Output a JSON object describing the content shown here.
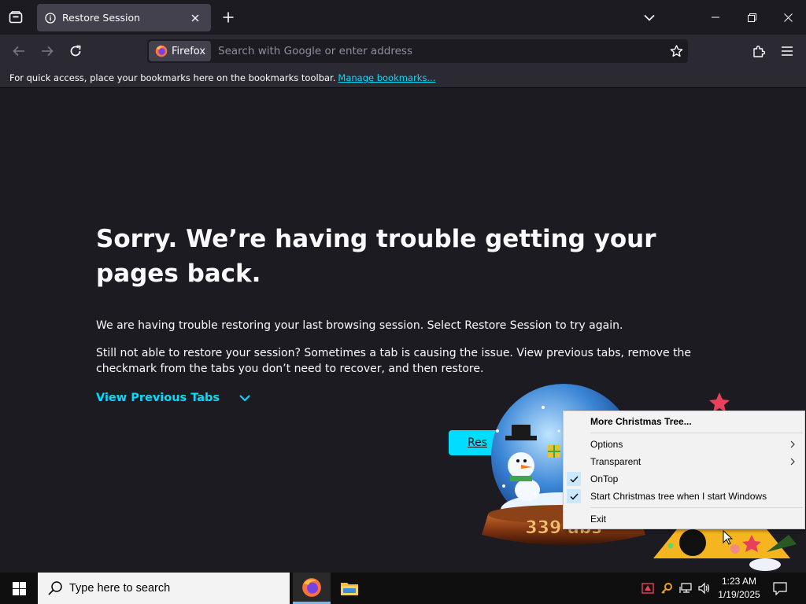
{
  "browser": {
    "tab": {
      "title": "Restore Session",
      "icon": "info-icon"
    },
    "urlbar": {
      "identity_label": "Firefox",
      "placeholder": "Search with Google or enter address"
    },
    "bookmarks_bar": {
      "message": "For quick access, place your bookmarks here on the bookmarks toolbar.",
      "link": "Manage bookmarks..."
    }
  },
  "page": {
    "heading": "Sorry. We’re having trouble getting your pages back.",
    "paragraph1": "We are having trouble restoring your last browsing session. Select Restore Session to try again.",
    "paragraph2": "Still not able to restore your session? Sometimes a tab is causing the issue. View previous tabs, remove the checkmark from the tabs you don’t need to recover, and then restore.",
    "view_previous_tabs": "View Previous Tabs",
    "restore_button_visible_text": "Res"
  },
  "widget": {
    "counter_text": "339 abs"
  },
  "context_menu": {
    "items": [
      {
        "label": "More Christmas Tree...",
        "bold": true
      },
      {
        "separator": true
      },
      {
        "label": "Options",
        "submenu": true
      },
      {
        "label": "Transparent",
        "submenu": true
      },
      {
        "label": "OnTop",
        "checked": true
      },
      {
        "label": "Start Christmas tree when I start Windows",
        "checked": true
      },
      {
        "separator": true
      },
      {
        "label": "Exit"
      }
    ]
  },
  "taskbar": {
    "search_placeholder": "Type here to search",
    "clock_time": "1:23 AM",
    "clock_date": "1/19/2025"
  },
  "colors": {
    "accent": "#00ddff",
    "content_bg": "#1c1b22",
    "toolbar_bg": "#2b2a33"
  }
}
